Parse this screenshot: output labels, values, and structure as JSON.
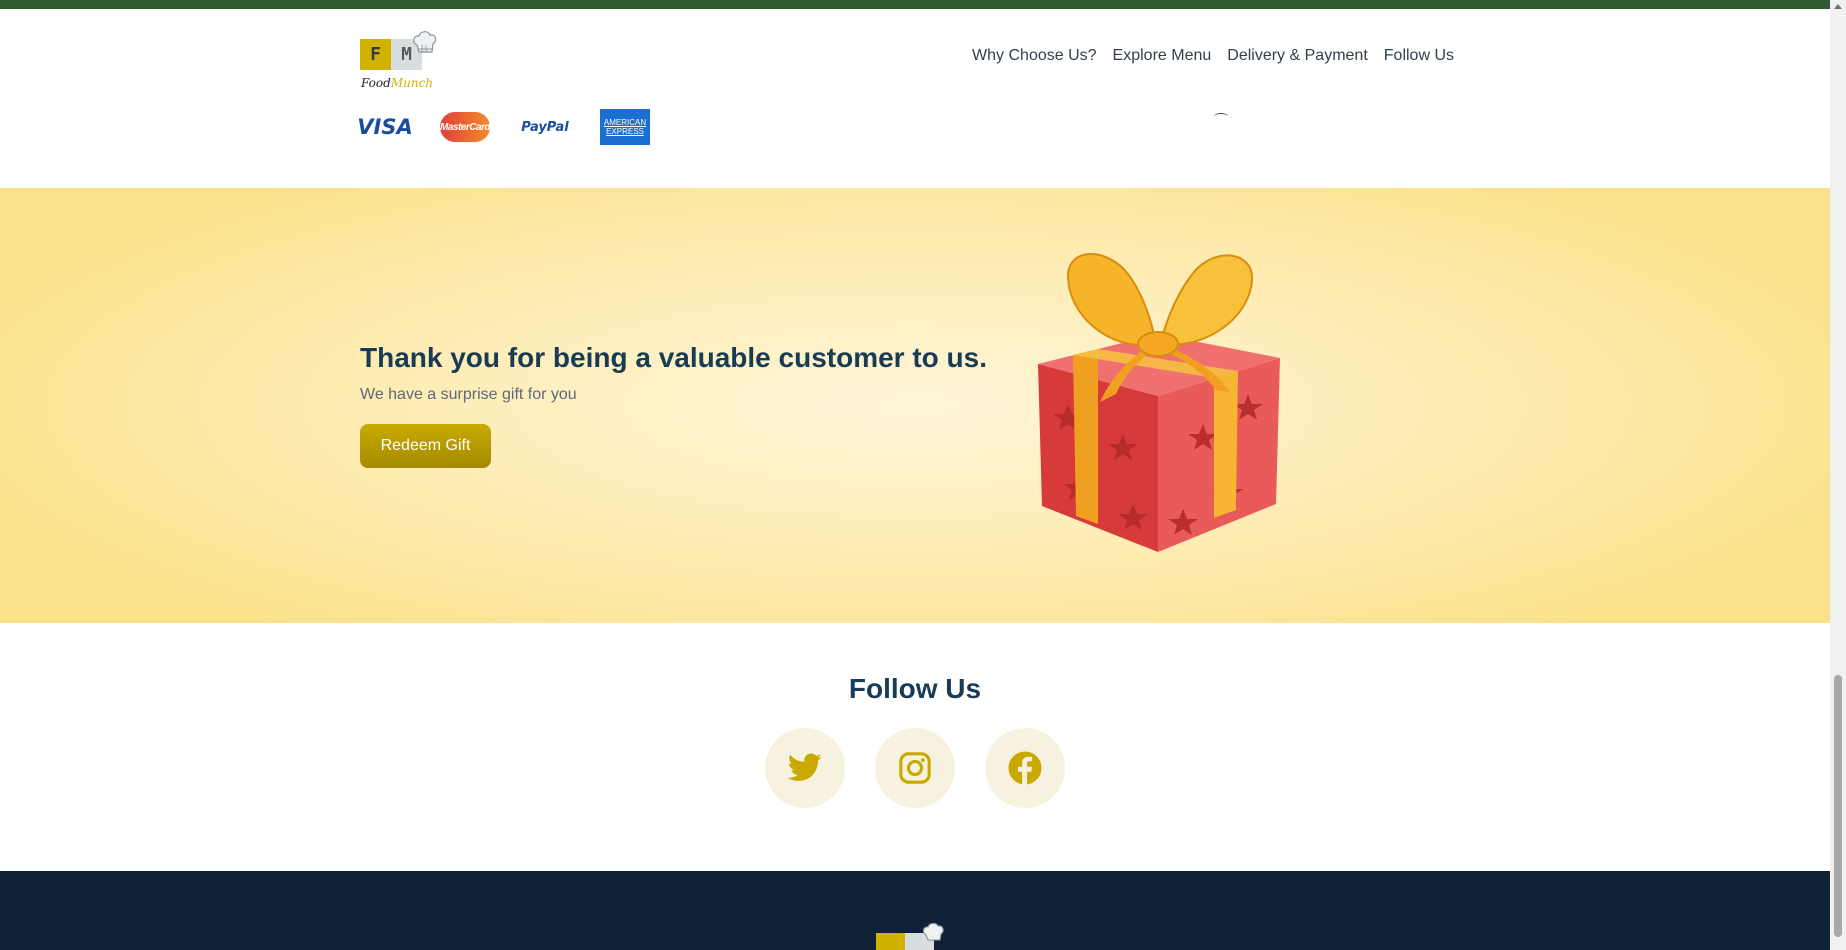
{
  "brand": {
    "name_part1": "Food",
    "name_part2": "Munch",
    "logo_letters": [
      "F",
      "M"
    ],
    "accent_color": "#d0b200"
  },
  "nav": {
    "links": [
      {
        "label": "Why Choose Us?"
      },
      {
        "label": "Explore Menu"
      },
      {
        "label": "Delivery & Payment"
      },
      {
        "label": "Follow Us"
      }
    ]
  },
  "payments": {
    "visa": "VISA",
    "mastercard": "MasterCard",
    "paypal": "PayPal",
    "amex_line1": "AMERICAN",
    "amex_line2": "EXPRESS"
  },
  "gift": {
    "heading": "Thank you for being a valuable customer to us.",
    "subtext": "We have a surprise gift for you",
    "button_label": "Redeem Gift"
  },
  "follow": {
    "title": "Follow Us",
    "icons": [
      "twitter-icon",
      "instagram-icon",
      "facebook-icon"
    ]
  },
  "colors": {
    "heading": "#183b56",
    "footer": "#0f2137",
    "topbar": "#2d5a2e",
    "button": "#b89a00"
  }
}
